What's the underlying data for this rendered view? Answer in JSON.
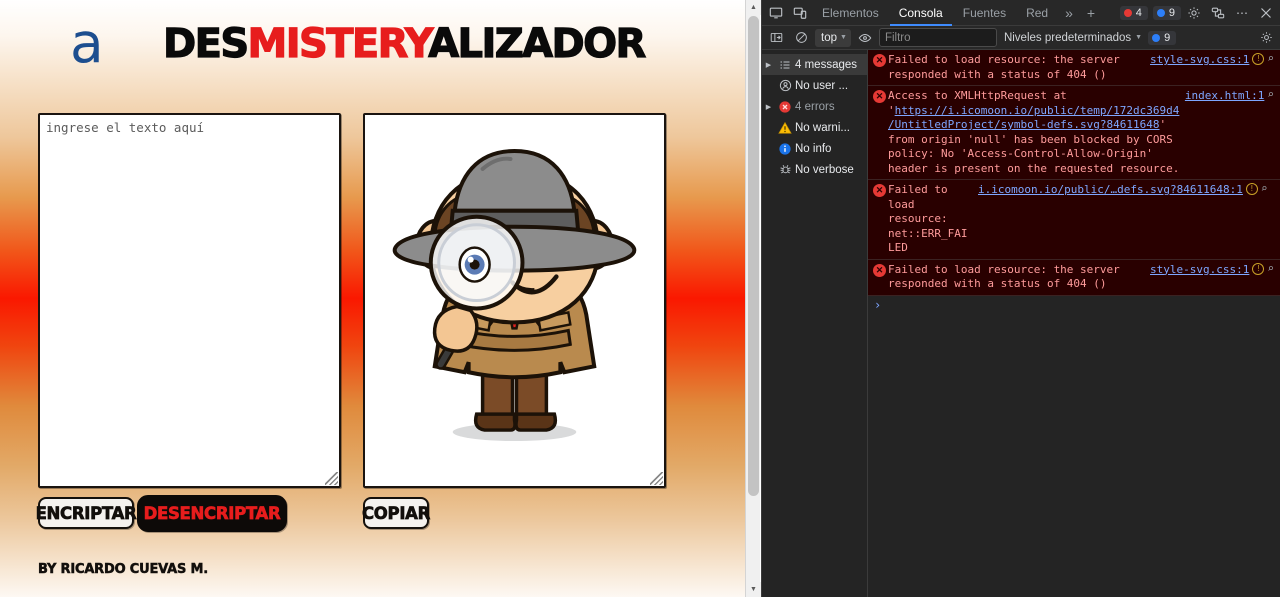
{
  "page": {
    "logo_letter": "a",
    "title_parts": [
      {
        "text": "DES",
        "color": "black"
      },
      {
        "text": "MISTERY",
        "color": "red"
      },
      {
        "text": "ALIZADOR",
        "color": "black"
      }
    ],
    "title_full": "DESMISTERYALIZADOR",
    "input": {
      "placeholder": "ingrese el texto aquí",
      "value": ""
    },
    "buttons": {
      "encrypt": "ENCRIPTAR",
      "decrypt": "DESENCRIPTAR",
      "copy": "COPIAR"
    },
    "credit": "BY RICARDO CUEVAS M.",
    "colors": {
      "accent_red": "#e71d1d",
      "logo_blue": "#1d4e8f",
      "bg_mid_red": "#fa1800",
      "bg_tan": "#e2a967"
    }
  },
  "devtools": {
    "tabs": [
      {
        "label": "Elementos",
        "active": false
      },
      {
        "label": "Consola",
        "active": true
      },
      {
        "label": "Fuentes",
        "active": false
      },
      {
        "label": "Red",
        "active": false
      }
    ],
    "more_tabs_label": "»",
    "add_tab_label": "+",
    "badges": [
      {
        "count": "4",
        "color": "#e53935",
        "name": "errors"
      },
      {
        "count": "9",
        "color": "#2d7ff9",
        "name": "issues"
      }
    ],
    "toolbar_icons": [
      "inspect-icon",
      "device-toolbar-icon",
      "settings-gear-icon",
      "customize-icon",
      "more-options-icon",
      "close-icon"
    ],
    "filterbar": {
      "sidebar_toggle": "sidebar-toggle-icon",
      "clear_console": "clear-console-icon",
      "context": "top",
      "eye_icon": "live-expression-icon",
      "filter_placeholder": "Filtro",
      "filter_value": "",
      "levels": "Niveles predeterminados",
      "issues_badge": "9",
      "settings_icon": "console-settings-icon"
    },
    "sidebar": [
      {
        "label": "4 messages",
        "icon": "list-icon",
        "selected": true,
        "twisty": true,
        "dim": false
      },
      {
        "label": "No user ...",
        "icon": "user-message-icon",
        "selected": false,
        "twisty": false,
        "dim": false
      },
      {
        "label": "4 errors",
        "icon": "error-icon",
        "selected": false,
        "twisty": true,
        "dim": true
      },
      {
        "label": "No warni...",
        "icon": "warning-icon",
        "selected": false,
        "twisty": false,
        "dim": false
      },
      {
        "label": "No info",
        "icon": "info-icon",
        "selected": false,
        "twisty": false,
        "dim": false
      },
      {
        "label": "No verbose",
        "icon": "verbose-bug-icon",
        "selected": false,
        "twisty": false,
        "dim": false
      }
    ],
    "messages": [
      {
        "level": "error",
        "text": "Failed to load resource: the server responded with a status of 404 ()",
        "source": "style-svg.css:1",
        "has_issue_icon": true,
        "has_search_icon": true
      },
      {
        "level": "error",
        "text_prefix": "Access to XMLHttpRequest at '",
        "link": "https://i.icomoon.io/public/temp/172dc369d4/UntitledProject/symbol-defs.svg?84611648",
        "text_suffix": "' from origin 'null' has been blocked by CORS policy: No 'Access-Control-Allow-Origin' header is present on the requested resource.",
        "source": "index.html:1",
        "has_issue_icon": false,
        "has_search_icon": true
      },
      {
        "level": "error",
        "text": "Failed to load resource: net::ERR_FAILED",
        "source": "i.icomoon.io/public/…defs.svg?84611648:1",
        "has_issue_icon": true,
        "has_search_icon": true
      },
      {
        "level": "error",
        "text": "Failed to load resource: the server responded with a status of 404 ()",
        "source": "style-svg.css:1",
        "has_issue_icon": true,
        "has_search_icon": true
      }
    ],
    "prompt_symbol": "›"
  }
}
